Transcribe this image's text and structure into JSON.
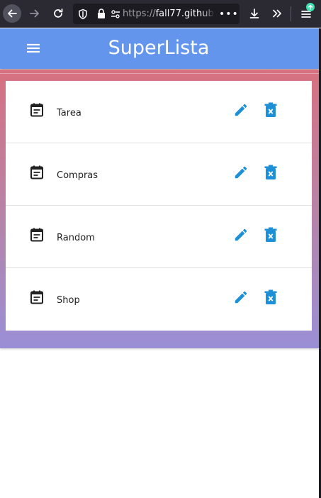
{
  "browser": {
    "url_protocol": "https://",
    "url_host": "fall77.github.",
    "more_label": "•••",
    "back_icon": "arrow-left-icon",
    "forward_icon": "arrow-right-icon",
    "reload_icon": "reload-icon",
    "shield_icon": "shield-icon",
    "lock_icon": "lock-icon",
    "permissions_icon": "permissions-icon",
    "download_icon": "download-icon",
    "overflow_icon": "chevrons-right-icon",
    "menu_icon": "hamburger-menu-icon",
    "update_icon": "update-available-icon",
    "chrome_color": "#2b2a33",
    "urlbar_color": "#1c1b22"
  },
  "header": {
    "title": "SuperLista",
    "menu_icon": "menu-icon",
    "color": "#6495ed"
  },
  "theme": {
    "gradient_top": "#d77180",
    "gradient_bottom": "#9a8fd6",
    "accent": "#1e90d8"
  },
  "lists": [
    {
      "label": "Tarea",
      "icon": "list-icon",
      "edit_icon": "pencil-icon",
      "delete_icon": "trash-icon"
    },
    {
      "label": "Compras",
      "icon": "list-icon",
      "edit_icon": "pencil-icon",
      "delete_icon": "trash-icon"
    },
    {
      "label": "Random",
      "icon": "list-icon",
      "edit_icon": "pencil-icon",
      "delete_icon": "trash-icon"
    },
    {
      "label": "Shop",
      "icon": "list-icon",
      "edit_icon": "pencil-icon",
      "delete_icon": "trash-icon"
    }
  ]
}
